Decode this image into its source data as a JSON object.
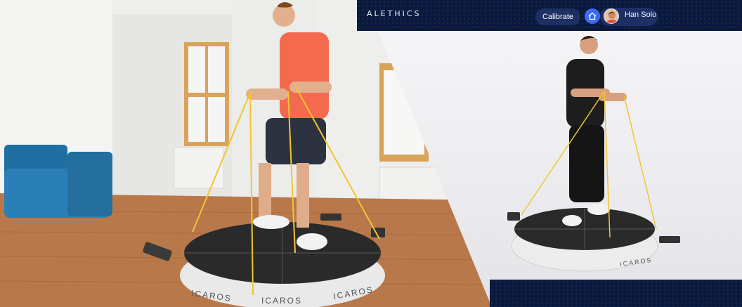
{
  "header": {
    "brand": "ALETHICS",
    "calibrate_label": "Calibrate",
    "home_icon": "home-icon",
    "user_name": "Han Solo"
  },
  "devices": {
    "left_labels": [
      "ICAROS",
      "ICAROS",
      "ICAROS"
    ],
    "right_label": "ICAROS"
  },
  "colors": {
    "nav_bg": "#0b1a3c",
    "accent": "#3a6cf0",
    "chip_bg": "#1d2f63"
  }
}
